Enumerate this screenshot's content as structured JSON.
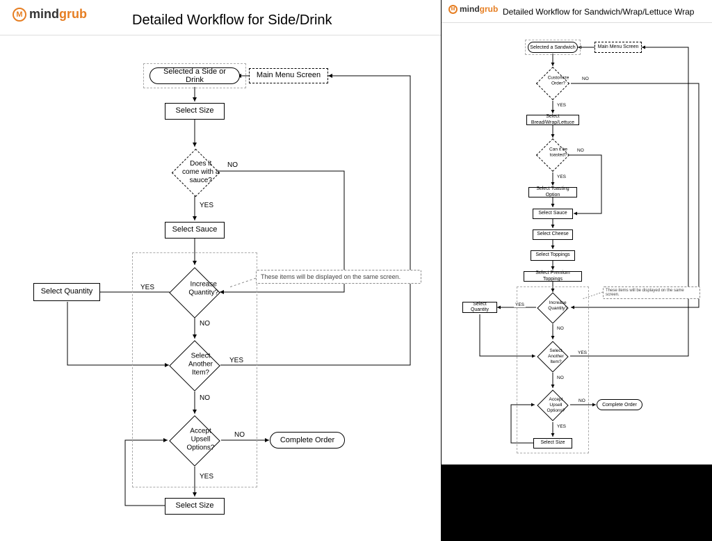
{
  "logo": {
    "mind": "mind",
    "grub": "grub",
    "icon_text": "M"
  },
  "left": {
    "title": "Detailed Workflow for Side/Drink",
    "nodes": {
      "start": "Selected  a Side or Drink",
      "mainmenu": "Main Menu Screen",
      "size": "Select Size",
      "sauce_q": "Does it come with a sauce?",
      "sauce": "Select Sauce",
      "qty_q": "Increase Quantity?",
      "qty": "Select Quantity",
      "another_q": "Select Another Item?",
      "upsell_q": "Accept Upsell Options?",
      "complete": "Complete Order",
      "size2": "Select Size",
      "note": "These items will be displayed on the same screen."
    },
    "labels": {
      "yes": "YES",
      "no": "NO"
    }
  },
  "right": {
    "title": "Detailed Workflow for Sandwich/Wrap/Lettuce Wrap",
    "nodes": {
      "start": "Selected a Sandwich",
      "mainmenu": "Main Menu Screen",
      "customize_q": "Customize Order?",
      "bread": "Select Bread/Wrap/Lettuce",
      "toast_q": "Can it be toasted?",
      "toast": "Select Toasting Option",
      "sauce": "Select Sauce",
      "cheese": "Select Cheese",
      "toppings": "Select Toppings",
      "premium": "Select Premium Toppings",
      "qty_q": "Increase Quantity?",
      "qty": "Select Quantity",
      "another_q": "Select Another Item?",
      "upsell_q": "Accept Upsell Options?",
      "complete": "Complete Order",
      "size": "Select Size",
      "note": "These items will be displayed on the same screen."
    },
    "labels": {
      "yes": "YES",
      "no": "NO"
    }
  }
}
